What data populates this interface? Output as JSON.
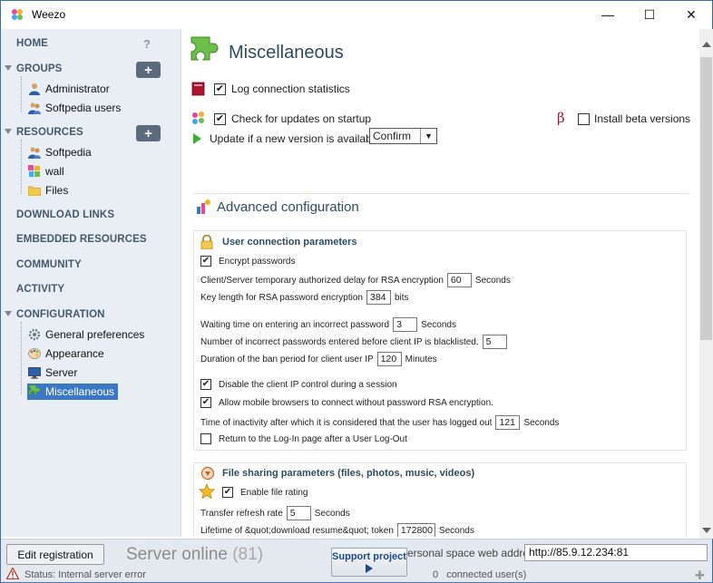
{
  "window": {
    "title": "Weezo",
    "minimize": "—",
    "maximize": "☐",
    "close": "✕"
  },
  "sidebar": {
    "home": "HOME",
    "help": "?",
    "groups": {
      "label": "GROUPS",
      "add": "+",
      "items": [
        "Administrator",
        "Softpedia users"
      ]
    },
    "resources": {
      "label": "RESOURCES",
      "add": "+",
      "items": [
        "Softpedia",
        "wall",
        "Files"
      ]
    },
    "download_links": "DOWNLOAD LINKS",
    "embedded_resources": "EMBEDDED RESOURCES",
    "community": "COMMUNITY",
    "activity": "ACTIVITY",
    "configuration": {
      "label": "CONFIGURATION",
      "items": [
        "General preferences",
        "Appearance",
        "Server",
        "Miscellaneous"
      ],
      "selected": "Miscellaneous"
    }
  },
  "main": {
    "title": "Miscellaneous",
    "log_connection": {
      "label": "Log connection statistics",
      "checked": true
    },
    "check_updates": {
      "label": "Check for updates on startup",
      "checked": true
    },
    "beta": {
      "symbol": "β",
      "label": "Install beta versions",
      "checked": false
    },
    "update_if": {
      "label": "Update if a new version is available",
      "value": "Confirm"
    },
    "advanced_title": "Advanced configuration",
    "user_conn": {
      "title": "User connection parameters",
      "encrypt": {
        "label": "Encrypt passwords",
        "checked": true
      },
      "rsa_delay": {
        "label": "Client/Server temporary authorized delay for RSA encryption",
        "value": "60",
        "unit": "Seconds"
      },
      "key_length": {
        "label": "Key length for RSA password encryption",
        "value": "384",
        "unit": "bits"
      },
      "wait_time": {
        "label": "Waiting time on entering an incorrect password",
        "value": "3",
        "unit": "Seconds"
      },
      "incorrect_count": {
        "label": "Number of incorrect passwords entered before client IP is blacklisted.",
        "value": "5"
      },
      "ban_duration": {
        "label": "Duration of the ban period for client user IP",
        "value": "120",
        "unit": "Minutes"
      },
      "disable_ip": {
        "label": "Disable the client IP control during a session",
        "checked": true
      },
      "mobile": {
        "label": "Allow mobile browsers to connect without password RSA encryption.",
        "checked": true
      },
      "inactivity": {
        "label": "Time of inactivity after which it is considered that the user has logged out",
        "value": "121",
        "unit": "Seconds"
      },
      "return_login": {
        "label": "Return to the Log-In page after a User Log-Out",
        "checked": false
      }
    },
    "file_sharing": {
      "title": "File sharing parameters (files, photos, music, videos)",
      "enable_rating": {
        "label": "Enable file rating",
        "checked": true
      },
      "refresh_rate": {
        "label": "Transfer refresh rate",
        "value": "5",
        "unit": "Seconds"
      },
      "lifetime": {
        "label": "Lifetime of &quot;download resume&quot; token",
        "value": "172800",
        "unit": "Seconds"
      }
    }
  },
  "bottom": {
    "edit_registration": "Edit registration",
    "server_status": "Server online",
    "server_count": "(81)",
    "support": "Support project",
    "web_address_label": "ersonal space web address",
    "web_address": "http://85.9.12.234:81",
    "status": "Status: Internal server error",
    "connected": "0",
    "connected_label": "connected user(s)"
  }
}
